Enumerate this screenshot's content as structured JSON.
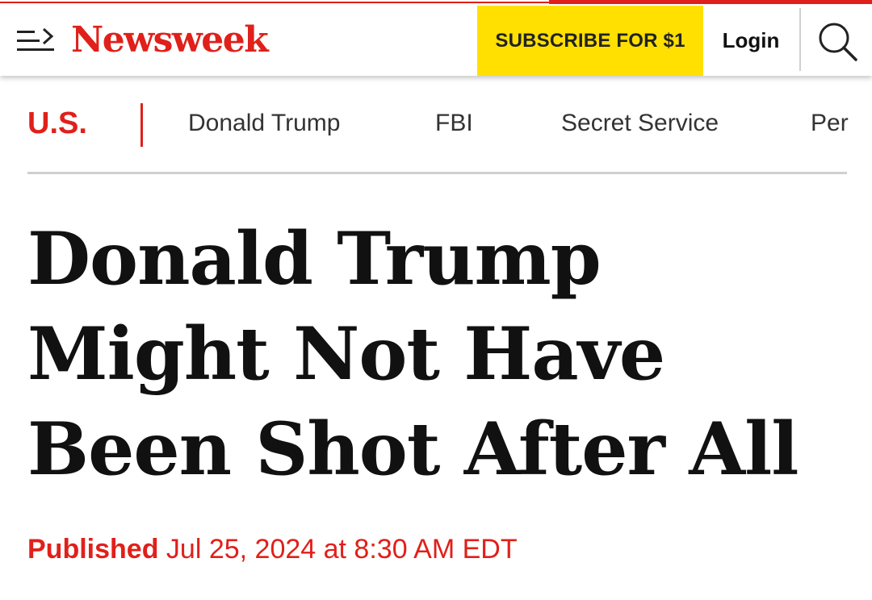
{
  "header": {
    "logo": "Newsweek",
    "subscribe_label": "SUBSCRIBE FOR $1",
    "login_label": "Login",
    "menu_icon": "menu-arrow-icon",
    "search_icon": "search-icon"
  },
  "subnav": {
    "section": "U.S.",
    "items": [
      "Donald Trump",
      "FBI",
      "Secret Service",
      "Per"
    ]
  },
  "article": {
    "headline": "Donald Trump Might Not Have Been Shot After All",
    "published_label": "Published",
    "published_date": "Jul 25, 2024 at 8:30 AM EDT"
  },
  "colors": {
    "brand_red": "#e0201a",
    "subscribe_yellow": "#ffe000"
  }
}
